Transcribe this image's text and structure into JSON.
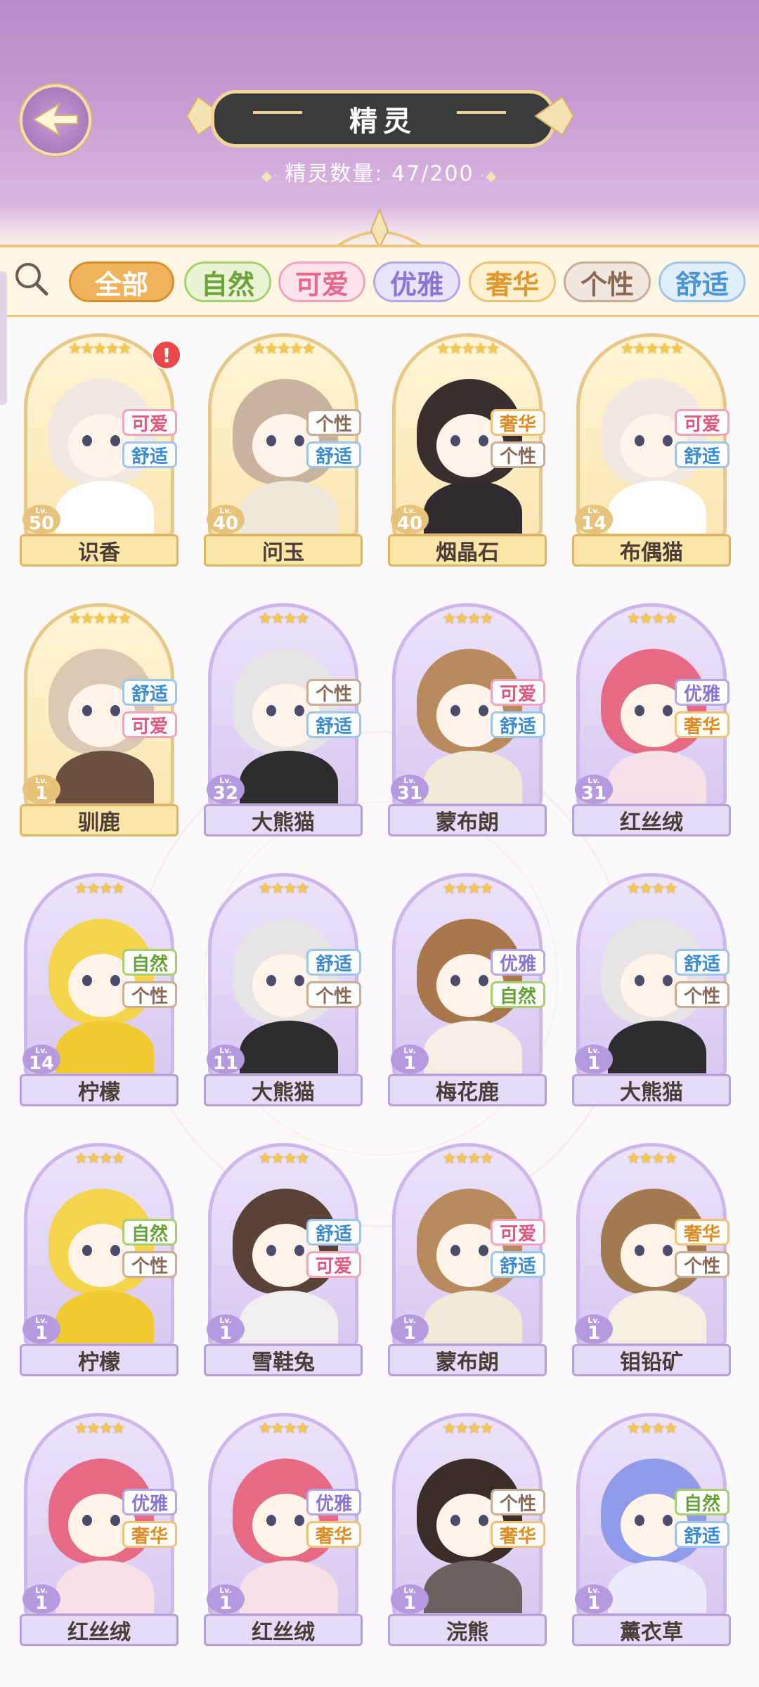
{
  "header": {
    "title": "精灵",
    "count_label": "精灵数量:",
    "count_value": "47/200"
  },
  "filters": [
    {
      "label": "全部",
      "active": true,
      "color": "#f0b25a",
      "text": "#ffffff",
      "border": "#d88f2e"
    },
    {
      "label": "自然",
      "active": false,
      "color": "#eaf5d6",
      "text": "#6da23a",
      "border": "#a6cf6e"
    },
    {
      "label": "可爱",
      "active": false,
      "color": "#fde4ec",
      "text": "#e56a8e",
      "border": "#f0a5bd"
    },
    {
      "label": "优雅",
      "active": false,
      "color": "#eae4fb",
      "text": "#8a74d6",
      "border": "#b6a6ec"
    },
    {
      "label": "奢华",
      "active": false,
      "color": "#fff1d2",
      "text": "#e0972e",
      "border": "#f2c274"
    },
    {
      "label": "个性",
      "active": false,
      "color": "#f1e7df",
      "text": "#8a6a57",
      "border": "#c9ad97"
    },
    {
      "label": "舒适",
      "active": false,
      "color": "#e2effb",
      "text": "#4b94d6",
      "border": "#9ec5ec"
    }
  ],
  "tag_styles": {
    "可爱": {
      "text": "#e0587f",
      "border": "#f0a5bd"
    },
    "舒适": {
      "text": "#3b8bd0",
      "border": "#9ec5ec"
    },
    "个性": {
      "text": "#8a6a57",
      "border": "#c9ad97"
    },
    "奢华": {
      "text": "#dc8c20",
      "border": "#f2c274"
    },
    "优雅": {
      "text": "#8a74d6",
      "border": "#b6a6ec"
    },
    "自然": {
      "text": "#67a136",
      "border": "#a6cf6e"
    }
  },
  "spirits": [
    {
      "name": "识香",
      "level": "50",
      "stars": "★★★★★",
      "frame": "gold",
      "tags": [
        "可爱",
        "舒适"
      ],
      "alert": true,
      "hair": "#f1e7e3",
      "body": "#ffffff"
    },
    {
      "name": "问玉",
      "level": "40",
      "stars": "★★★★★",
      "frame": "gold",
      "tags": [
        "个性",
        "舒适"
      ],
      "alert": false,
      "hair": "#c8b39e",
      "body": "#efe6dc"
    },
    {
      "name": "烟晶石",
      "level": "40",
      "stars": "★★★★★",
      "frame": "gold",
      "tags": [
        "奢华",
        "个性"
      ],
      "alert": false,
      "hair": "#3a2e2e",
      "body": "#2f2b2e"
    },
    {
      "name": "布偶猫",
      "level": "14",
      "stars": "★★★★★",
      "frame": "gold",
      "tags": [
        "可爱",
        "舒适"
      ],
      "alert": false,
      "hair": "#f1e7e3",
      "body": "#ffffff"
    },
    {
      "name": "驯鹿",
      "level": "1",
      "stars": "★★★★★",
      "frame": "gold",
      "tags": [
        "舒适",
        "可爱"
      ],
      "alert": false,
      "hair": "#d9c9b3",
      "body": "#6b4f3f"
    },
    {
      "name": "大熊猫",
      "level": "32",
      "stars": "★★★★",
      "frame": "purple",
      "tags": [
        "个性",
        "舒适"
      ],
      "alert": false,
      "hair": "#e6e4e4",
      "body": "#2c2c2e"
    },
    {
      "name": "蒙布朗",
      "level": "31",
      "stars": "★★★★",
      "frame": "purple",
      "tags": [
        "可爱",
        "舒适"
      ],
      "alert": false,
      "hair": "#b98a5e",
      "body": "#f2ead9"
    },
    {
      "name": "红丝绒",
      "level": "31",
      "stars": "★★★★",
      "frame": "purple",
      "tags": [
        "优雅",
        "奢华"
      ],
      "alert": false,
      "hair": "#e66a86",
      "body": "#f6e1e6"
    },
    {
      "name": "柠檬",
      "level": "14",
      "stars": "★★★★",
      "frame": "purple",
      "tags": [
        "自然",
        "个性"
      ],
      "alert": false,
      "hair": "#f3d44a",
      "body": "#f1c930"
    },
    {
      "name": "大熊猫",
      "level": "11",
      "stars": "★★★★",
      "frame": "purple",
      "tags": [
        "舒适",
        "个性"
      ],
      "alert": false,
      "hair": "#e6e4e4",
      "body": "#2c2c2e"
    },
    {
      "name": "梅花鹿",
      "level": "1",
      "stars": "★★★★",
      "frame": "purple",
      "tags": [
        "优雅",
        "自然"
      ],
      "alert": false,
      "hair": "#a8774c",
      "body": "#f5efe6"
    },
    {
      "name": "大熊猫",
      "level": "1",
      "stars": "★★★★",
      "frame": "purple",
      "tags": [
        "舒适",
        "个性"
      ],
      "alert": false,
      "hair": "#e6e4e4",
      "body": "#2c2c2e"
    },
    {
      "name": "柠檬",
      "level": "1",
      "stars": "★★★★",
      "frame": "purple",
      "tags": [
        "自然",
        "个性"
      ],
      "alert": false,
      "hair": "#f3d44a",
      "body": "#f1c930"
    },
    {
      "name": "雪鞋兔",
      "level": "1",
      "stars": "★★★★",
      "frame": "purple",
      "tags": [
        "舒适",
        "可爱"
      ],
      "alert": false,
      "hair": "#5a4236",
      "body": "#f1eef0"
    },
    {
      "name": "蒙布朗",
      "level": "1",
      "stars": "★★★★",
      "frame": "purple",
      "tags": [
        "可爱",
        "舒适"
      ],
      "alert": false,
      "hair": "#b98a5e",
      "body": "#f2ead9"
    },
    {
      "name": "钼铅矿",
      "level": "1",
      "stars": "★★★★",
      "frame": "purple",
      "tags": [
        "奢华",
        "个性"
      ],
      "alert": false,
      "hair": "#a17a52",
      "body": "#f5efe2"
    },
    {
      "name": "红丝绒",
      "level": "1",
      "stars": "★★★★",
      "frame": "purple",
      "tags": [
        "优雅",
        "奢华"
      ],
      "alert": false,
      "hair": "#e66a86",
      "body": "#f6e1e6"
    },
    {
      "name": "红丝绒",
      "level": "1",
      "stars": "★★★★",
      "frame": "purple",
      "tags": [
        "优雅",
        "奢华"
      ],
      "alert": false,
      "hair": "#e66a86",
      "body": "#f6e1e6"
    },
    {
      "name": "浣熊",
      "level": "1",
      "stars": "★★★★",
      "frame": "purple",
      "tags": [
        "个性",
        "奢华"
      ],
      "alert": false,
      "hair": "#3b2e28",
      "body": "#6c6060"
    },
    {
      "name": "薰衣草",
      "level": "1",
      "stars": "★★★★",
      "frame": "purple",
      "tags": [
        "自然",
        "舒适"
      ],
      "alert": false,
      "hair": "#8f9be8",
      "body": "#ece9fb"
    }
  ],
  "level_prefix": "Lv."
}
